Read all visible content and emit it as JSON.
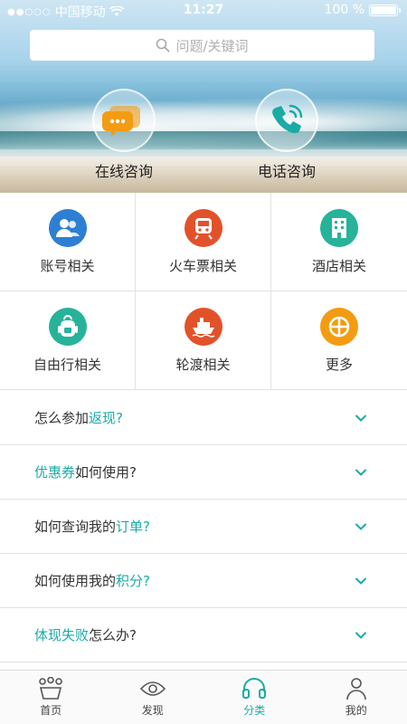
{
  "status": {
    "carrier": "中国移动",
    "time": "11:27",
    "battery": "100 %"
  },
  "search": {
    "placeholder": "问题/关键词"
  },
  "consult": [
    {
      "label": "在线咨询",
      "icon": "chat-bubbles-icon",
      "color": "#f39c12"
    },
    {
      "label": "电话咨询",
      "icon": "phone-icon",
      "color": "#1aaba5"
    }
  ],
  "categories": [
    {
      "label": "账号相关",
      "icon": "users-icon",
      "color": "#2d7fd3"
    },
    {
      "label": "火车票相关",
      "icon": "train-icon",
      "color": "#e2522a"
    },
    {
      "label": "酒店相关",
      "icon": "hotel-icon",
      "color": "#26b39a"
    },
    {
      "label": "自由行相关",
      "icon": "backpack-icon",
      "color": "#26b39a"
    },
    {
      "label": "轮渡相关",
      "icon": "ship-icon",
      "color": "#e2522a"
    },
    {
      "label": "更多",
      "icon": "more-icon",
      "color": "#f39c12"
    }
  ],
  "faq": [
    {
      "pre": "怎么参加",
      "hl": "返现?",
      "post": ""
    },
    {
      "pre": "",
      "hl": "优惠券",
      "post": "如何使用?"
    },
    {
      "pre": "如何查询我的",
      "hl": "订单?",
      "post": ""
    },
    {
      "pre": "如何使用我的",
      "hl": "积分?",
      "post": ""
    },
    {
      "pre": "",
      "hl": "体现失败",
      "post": "怎么办?"
    }
  ],
  "tabs": [
    {
      "label": "首页",
      "icon": "home-icon"
    },
    {
      "label": "发现",
      "icon": "eye-icon"
    },
    {
      "label": "分类",
      "icon": "headset-icon",
      "active": true
    },
    {
      "label": "我的",
      "icon": "person-icon"
    }
  ],
  "colors": {
    "accent": "#1aaba5",
    "divider": "#e2e2e2"
  }
}
